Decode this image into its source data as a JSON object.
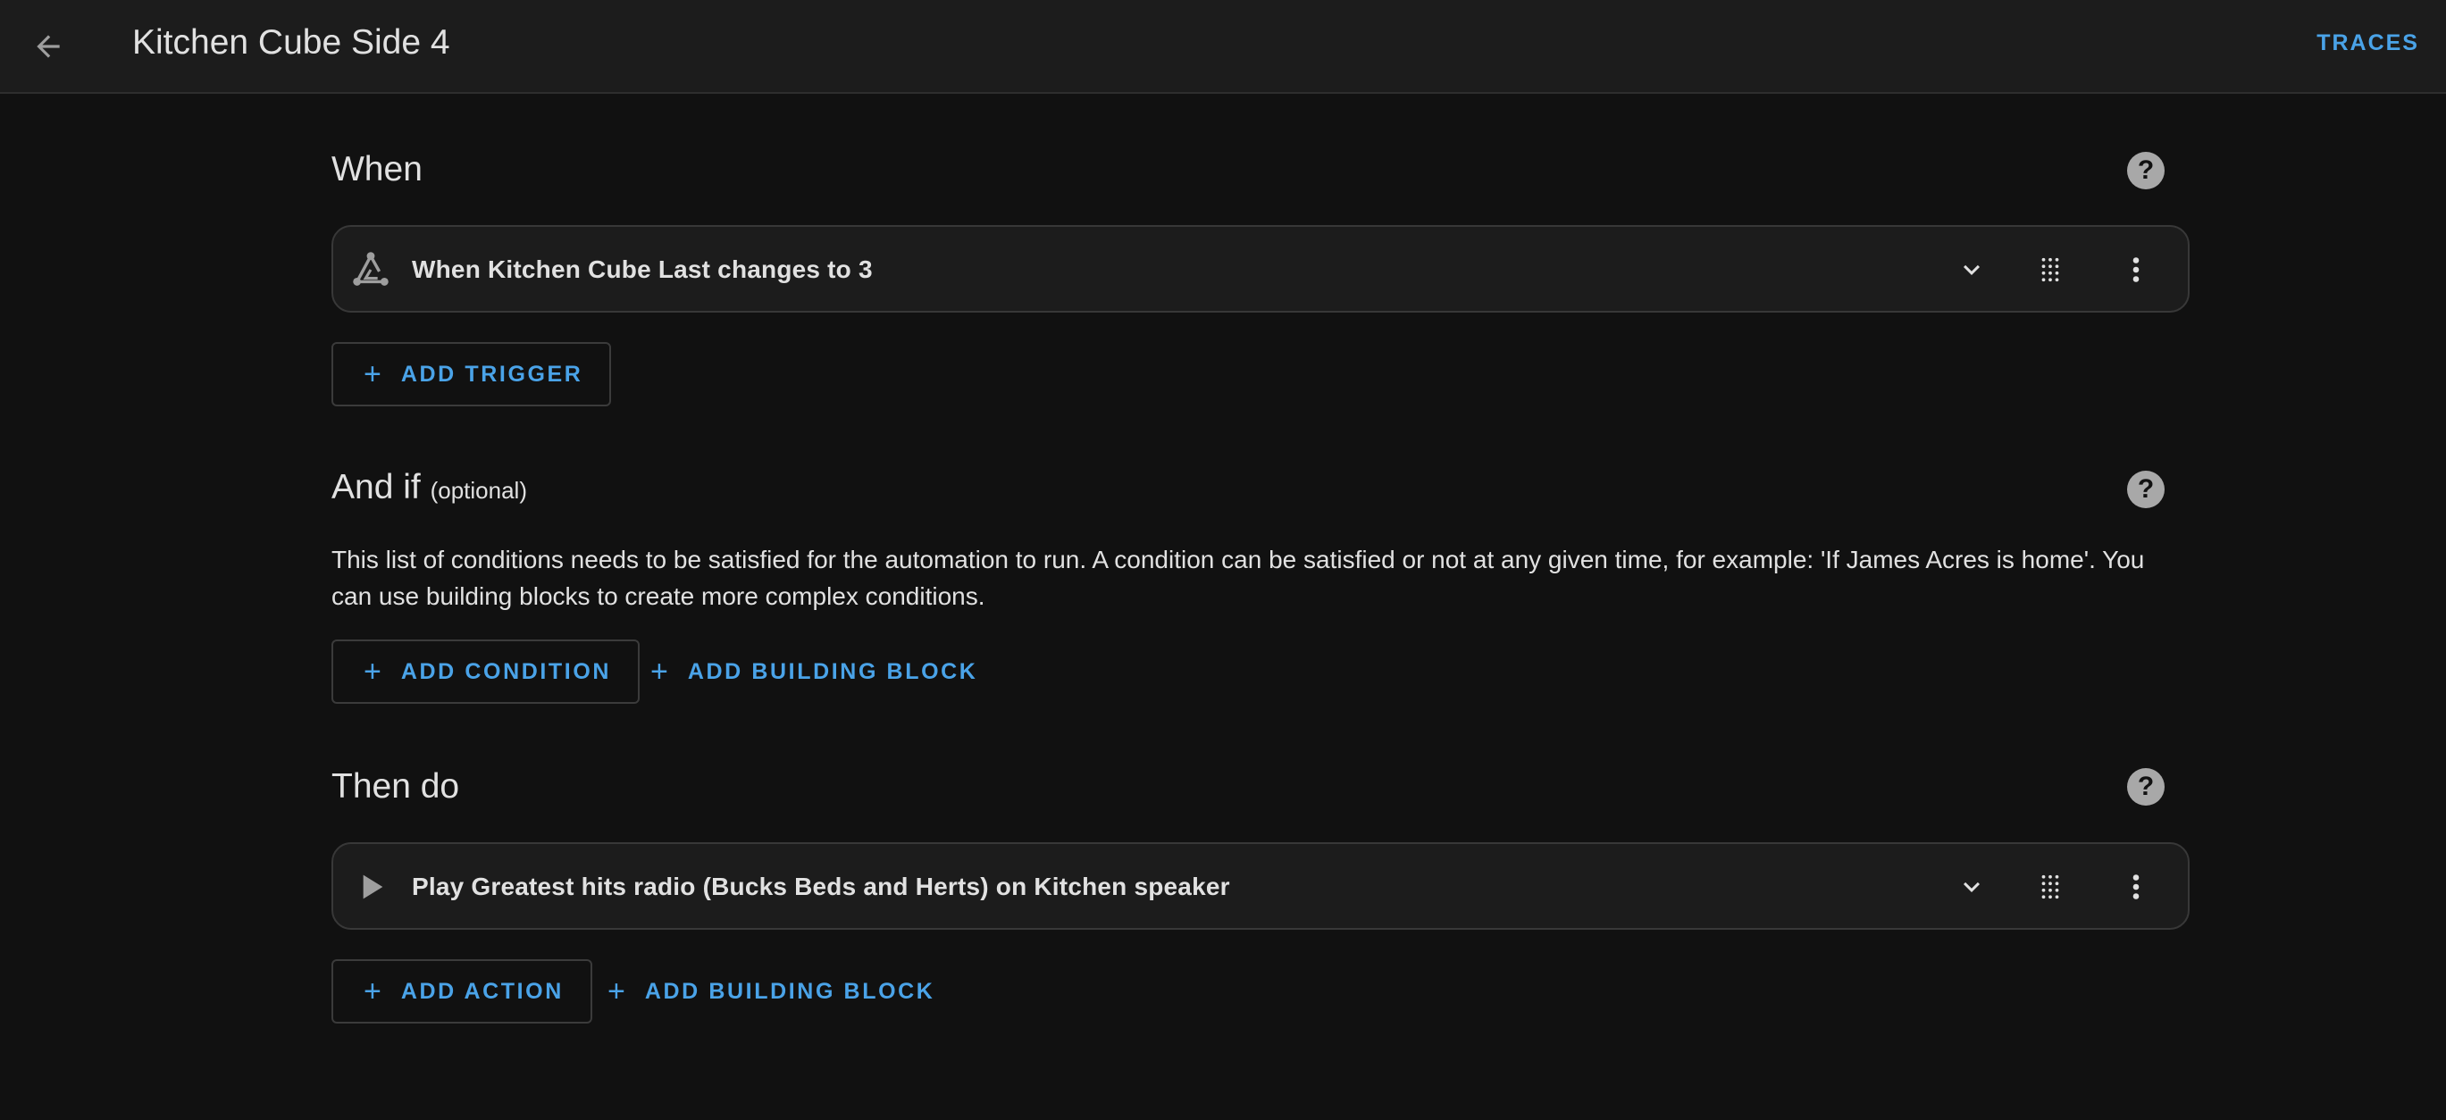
{
  "header": {
    "title": "Kitchen Cube Side 4",
    "traces_label": "TRACES"
  },
  "icons": {
    "back": "arrow-left-icon",
    "help": "help-circle-icon",
    "trigger": "trigger-graph-icon",
    "action": "play-icon",
    "expand": "chevron-down-icon",
    "drag": "drag-handle-icon",
    "menu": "more-vertical-icon"
  },
  "colors": {
    "accent": "#4aa3e8",
    "background": "#111111",
    "card": "#1c1c1c"
  },
  "when": {
    "heading": "When",
    "help": "?",
    "trigger_label": "When Kitchen Cube Last changes to 3",
    "add_trigger": "ADD TRIGGER",
    "plus": "+"
  },
  "and_if": {
    "heading": "And if",
    "optional": "(optional)",
    "help": "?",
    "description": "This list of conditions needs to be satisfied for the automation to run. A condition can be satisfied or not at any given time, for example: 'If James Acres is home'. You can use building blocks to create more complex conditions.",
    "add_condition": "ADD CONDITION",
    "add_building_block": "ADD BUILDING BLOCK",
    "plus": "+"
  },
  "then_do": {
    "heading": "Then do",
    "help": "?",
    "action_label": "Play Greatest hits radio (Bucks Beds and Herts) on Kitchen speaker",
    "add_action": "ADD ACTION",
    "add_building_block": "ADD BUILDING BLOCK",
    "plus": "+"
  }
}
